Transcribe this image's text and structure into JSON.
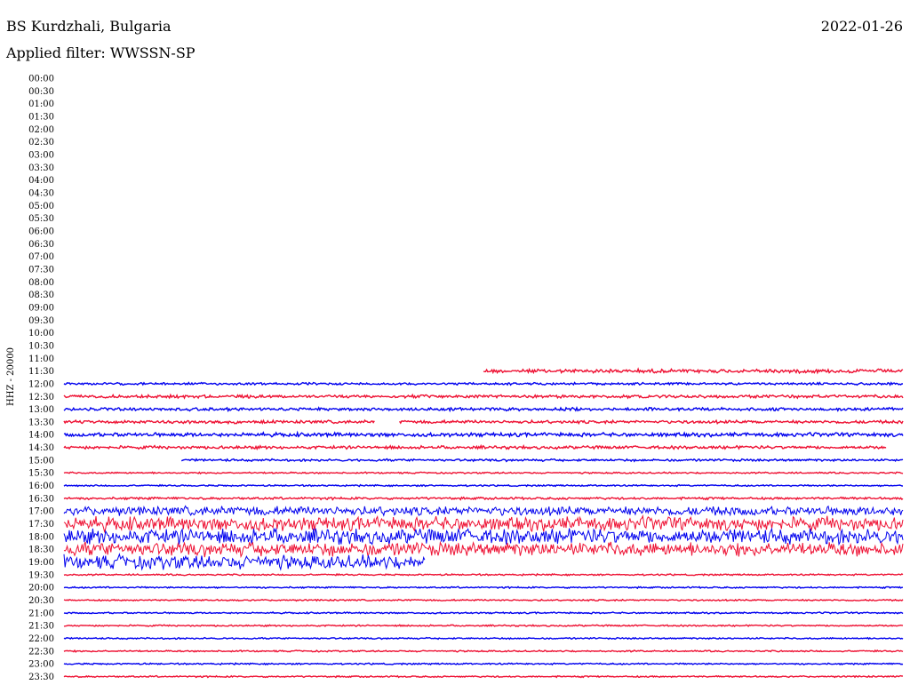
{
  "header": {
    "station": "BS Kurdzhali, Bulgaria",
    "date": "2022-01-26",
    "filter": "Applied filter: WWSSN-SP"
  },
  "colors": {
    "blue": "#0000ee",
    "red": "#ee1133"
  },
  "chart_data": {
    "type": "line",
    "title": "BS Kurdzhali, Bulgaria",
    "channel_label": "HHZ - 20000",
    "time_labels": [
      "00:00",
      "00:30",
      "01:00",
      "01:30",
      "02:00",
      "02:30",
      "03:00",
      "03:30",
      "04:00",
      "04:30",
      "05:00",
      "05:30",
      "06:00",
      "06:30",
      "07:00",
      "07:30",
      "08:00",
      "08:30",
      "09:00",
      "09:30",
      "10:00",
      "10:30",
      "11:00",
      "11:30",
      "12:00",
      "12:30",
      "13:00",
      "13:30",
      "14:00",
      "14:30",
      "15:00",
      "15:30",
      "16:00",
      "16:30",
      "17:00",
      "17:30",
      "18:00",
      "18:30",
      "19:00",
      "19:30",
      "20:00",
      "20:30",
      "21:00",
      "21:30",
      "22:00",
      "22:30",
      "23:00",
      "23:30"
    ],
    "traces": [
      {
        "row": 23,
        "color": "red",
        "start": 0.5,
        "end": 1.0,
        "amp": 2.5
      },
      {
        "row": 24,
        "color": "blue",
        "start": 0.0,
        "end": 1.0,
        "amp": 1.5
      },
      {
        "row": 25,
        "color": "red",
        "start": 0.0,
        "end": 1.0,
        "amp": 2
      },
      {
        "row": 26,
        "color": "blue",
        "start": 0.0,
        "end": 1.0,
        "amp": 2
      },
      {
        "row": 27,
        "color": "red",
        "start": 0.0,
        "end": 0.37,
        "amp": 2
      },
      {
        "row": 27,
        "color": "red",
        "start": 0.4,
        "end": 1.0,
        "amp": 2
      },
      {
        "row": 28,
        "color": "blue",
        "start": 0.0,
        "end": 1.0,
        "amp": 2.5
      },
      {
        "row": 29,
        "color": "red",
        "start": 0.0,
        "end": 0.98,
        "amp": 2
      },
      {
        "row": 30,
        "color": "blue",
        "start": 0.14,
        "end": 1.0,
        "amp": 1.5
      },
      {
        "row": 31,
        "color": "red",
        "start": 0.0,
        "end": 1.0,
        "amp": 1
      },
      {
        "row": 32,
        "color": "blue",
        "start": 0.0,
        "end": 1.0,
        "amp": 1
      },
      {
        "row": 33,
        "color": "red",
        "start": 0.0,
        "end": 1.0,
        "amp": 1.5
      },
      {
        "row": 34,
        "color": "blue",
        "start": 0.0,
        "end": 1.0,
        "amp": 6
      },
      {
        "row": 35,
        "color": "red",
        "start": 0.0,
        "end": 1.0,
        "amp": 9
      },
      {
        "row": 36,
        "color": "blue",
        "start": 0.0,
        "end": 1.0,
        "amp": 10
      },
      {
        "row": 37,
        "color": "red",
        "start": 0.0,
        "end": 1.0,
        "amp": 9
      },
      {
        "row": 38,
        "color": "blue",
        "start": 0.0,
        "end": 0.43,
        "amp": 9
      },
      {
        "row": 39,
        "color": "red",
        "start": 0.0,
        "end": 1.0,
        "amp": 1
      },
      {
        "row": 40,
        "color": "blue",
        "start": 0.0,
        "end": 1.0,
        "amp": 1
      },
      {
        "row": 41,
        "color": "red",
        "start": 0.0,
        "end": 1.0,
        "amp": 1
      },
      {
        "row": 42,
        "color": "blue",
        "start": 0.0,
        "end": 1.0,
        "amp": 1
      },
      {
        "row": 43,
        "color": "red",
        "start": 0.0,
        "end": 1.0,
        "amp": 1
      },
      {
        "row": 44,
        "color": "blue",
        "start": 0.0,
        "end": 1.0,
        "amp": 1
      },
      {
        "row": 45,
        "color": "red",
        "start": 0.0,
        "end": 1.0,
        "amp": 1
      },
      {
        "row": 46,
        "color": "blue",
        "start": 0.0,
        "end": 1.0,
        "amp": 1
      },
      {
        "row": 47,
        "color": "red",
        "start": 0.0,
        "end": 1.0,
        "amp": 1
      }
    ]
  }
}
